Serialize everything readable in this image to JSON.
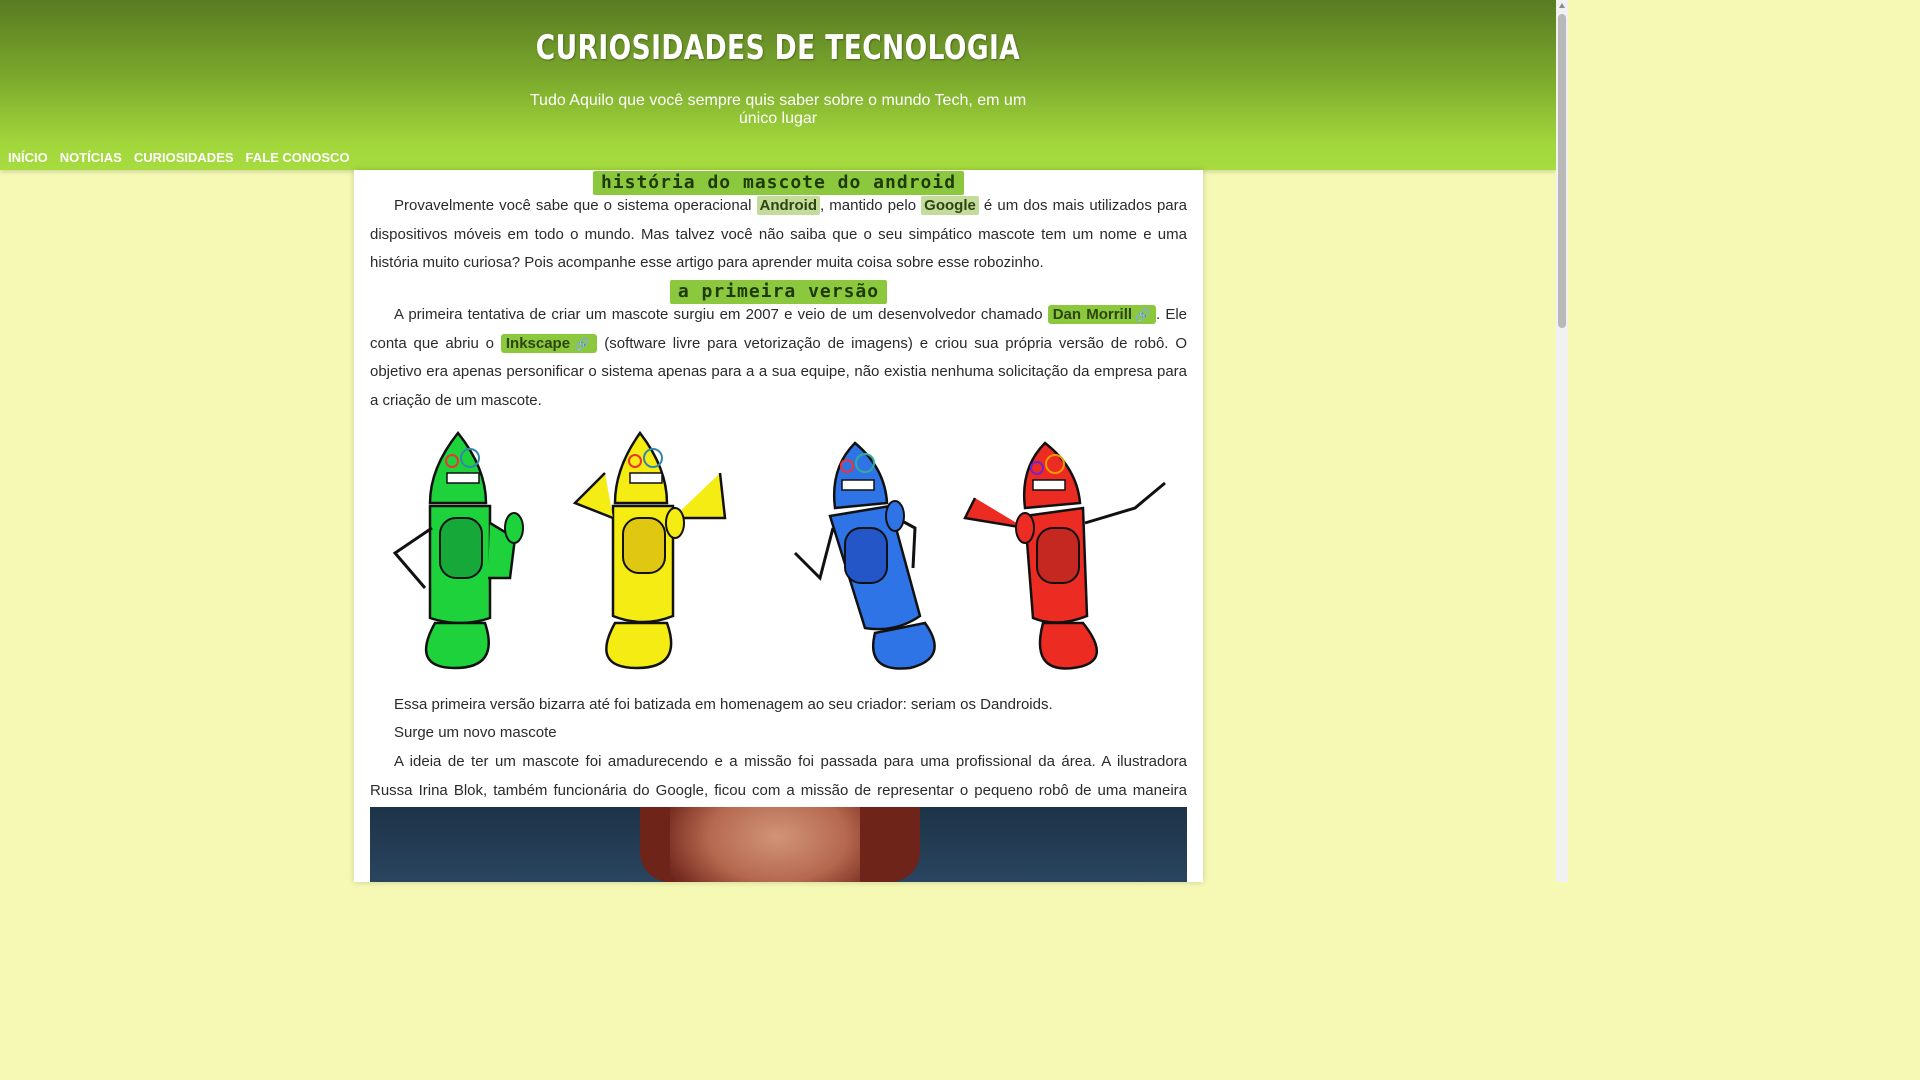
{
  "header": {
    "title": "CURIOSIDADES DE TECNOLOGIA",
    "subtitle": "Tudo Aquilo que você sempre quis saber sobre o mundo Tech, em um único lugar"
  },
  "nav": {
    "items": [
      "INÍCIO",
      "NOTÍCIAS",
      "CURIOSIDADES",
      "FALE CONOSCO"
    ]
  },
  "article": {
    "heading1": "HISTÓRIA DO MASCOTE DO ANDROID",
    "intro": {
      "text1": "Provavelmente você sabe que o sistema operacional ",
      "hl1": "Android",
      "text2": ", mantido pelo ",
      "hl2": "Google",
      "text3": " é um dos mais utilizados para dispositivos móveis em todo o mundo. Mas talvez você não saiba que o seu simpático mascote tem um nome e uma história muito curiosa? Pois acompanhe esse artigo para aprender muita coisa sobre esse robozinho."
    },
    "heading2": "A PRIMEIRA VERSÃO",
    "first": {
      "text1": "A primeira tentativa de criar um mascote surgiu em 2007 e veio de um desenvolvedor chamado ",
      "link1": "Dan Morrill",
      "text2": ". Ele conta que abriu o ",
      "link2": "Inkscape",
      "text3": " (software livre para vetorização de imagens) e criou sua própria versão de robô. O objetivo era apenas personificar o sistema apenas para a a sua equipe, não existia nenhuma solicitação da empresa para a criação de um mascote."
    },
    "robots": {
      "colors": [
        "#1ed23c",
        "#f5ec14",
        "#2f74e6",
        "#ec2b22"
      ],
      "inner_colors": [
        "#17a83a",
        "#e0c812",
        "#2456c8",
        "#c42820"
      ]
    },
    "para_dandroids": "Essa primeira versão bizarra até foi batizada em homenagem ao seu criador: seriam os Dandroids.",
    "para_novo": "Surge um novo mascote",
    "para_ideia": "A ideia de ter um mascote foi amadurecendo e a missão foi passada para uma profissional da área. A ilustradora Russa Irina Blok, também funcionária do Google, ficou com a missão de representar o pequeno robô de uma maneira mais agradável"
  }
}
